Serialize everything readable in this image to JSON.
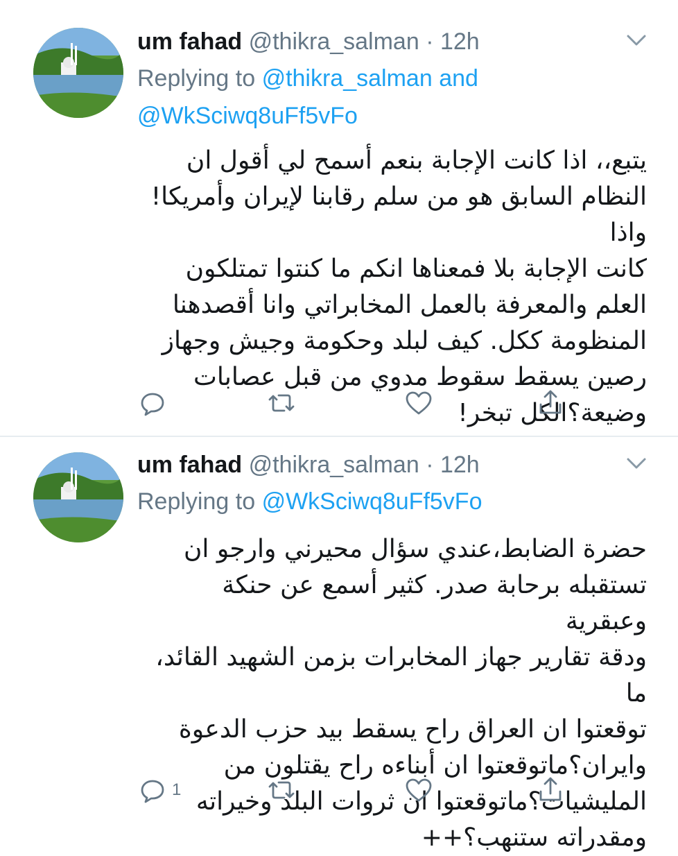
{
  "tweets": [
    {
      "user": {
        "name": "um fahad",
        "handle": "@thikra_salman"
      },
      "time": "12h",
      "reply_prefix": "Replying to",
      "reply_mentions": [
        "@thikra_salman",
        "@WkSciwq8uFf5vFo"
      ],
      "reply_and": "and",
      "body_lines": [
        "يتبع،، اذا كانت الإجابة بنعم أسمح لي أقول ان",
        "النظام السابق هو من سلم رقابنا لإيران وأمريكا!واذا",
        "كانت الإجابة بلا فمعناها انكم ما كنتوا تمتلكون",
        "العلم والمعرفة بالعمل المخابراتي وانا أقصدهنا",
        "المنظومة ككل. كيف لبلد وحكومة وجيش وجهاز",
        "رصين يسقط سقوط مدوي من قبل عصابات",
        "وضيعة؟الكل تبخر!"
      ],
      "actions": {
        "reply": "reply-icon",
        "retweet": "retweet-icon",
        "like": "like-icon",
        "share": "share-icon",
        "reply_count": ""
      }
    },
    {
      "user": {
        "name": "um fahad",
        "handle": "@thikra_salman"
      },
      "time": "12h",
      "reply_prefix": "Replying to",
      "reply_mentions": [
        "@WkSciwq8uFf5vFo"
      ],
      "body_lines": [
        "حضرة الضابط،عندي سؤال محيرني وارجو ان",
        "تستقبله برحابة صدر. كثير أسمع عن حنكة وعبقرية",
        "ودقة تقارير جهاز المخابرات بزمن الشهيد القائد، ما",
        "توقعتوا ان العراق راح يسقط بيد حزب الدعوة",
        "وايران؟ماتوقعتوا ان أبناءه راح يقتلون من",
        "المليشيات؟ماتوقعتوا ان ثروات البلد وخيراته",
        "ومقدراته ستنهب؟++"
      ],
      "actions": {
        "reply": "reply-icon",
        "retweet": "retweet-icon",
        "like": "like-icon",
        "share": "share-icon",
        "reply_count": "1"
      }
    }
  ],
  "colors": {
    "accent": "#1da1f2",
    "secondary": "#657786",
    "text": "#14171a",
    "divider": "#e6ecf0"
  }
}
